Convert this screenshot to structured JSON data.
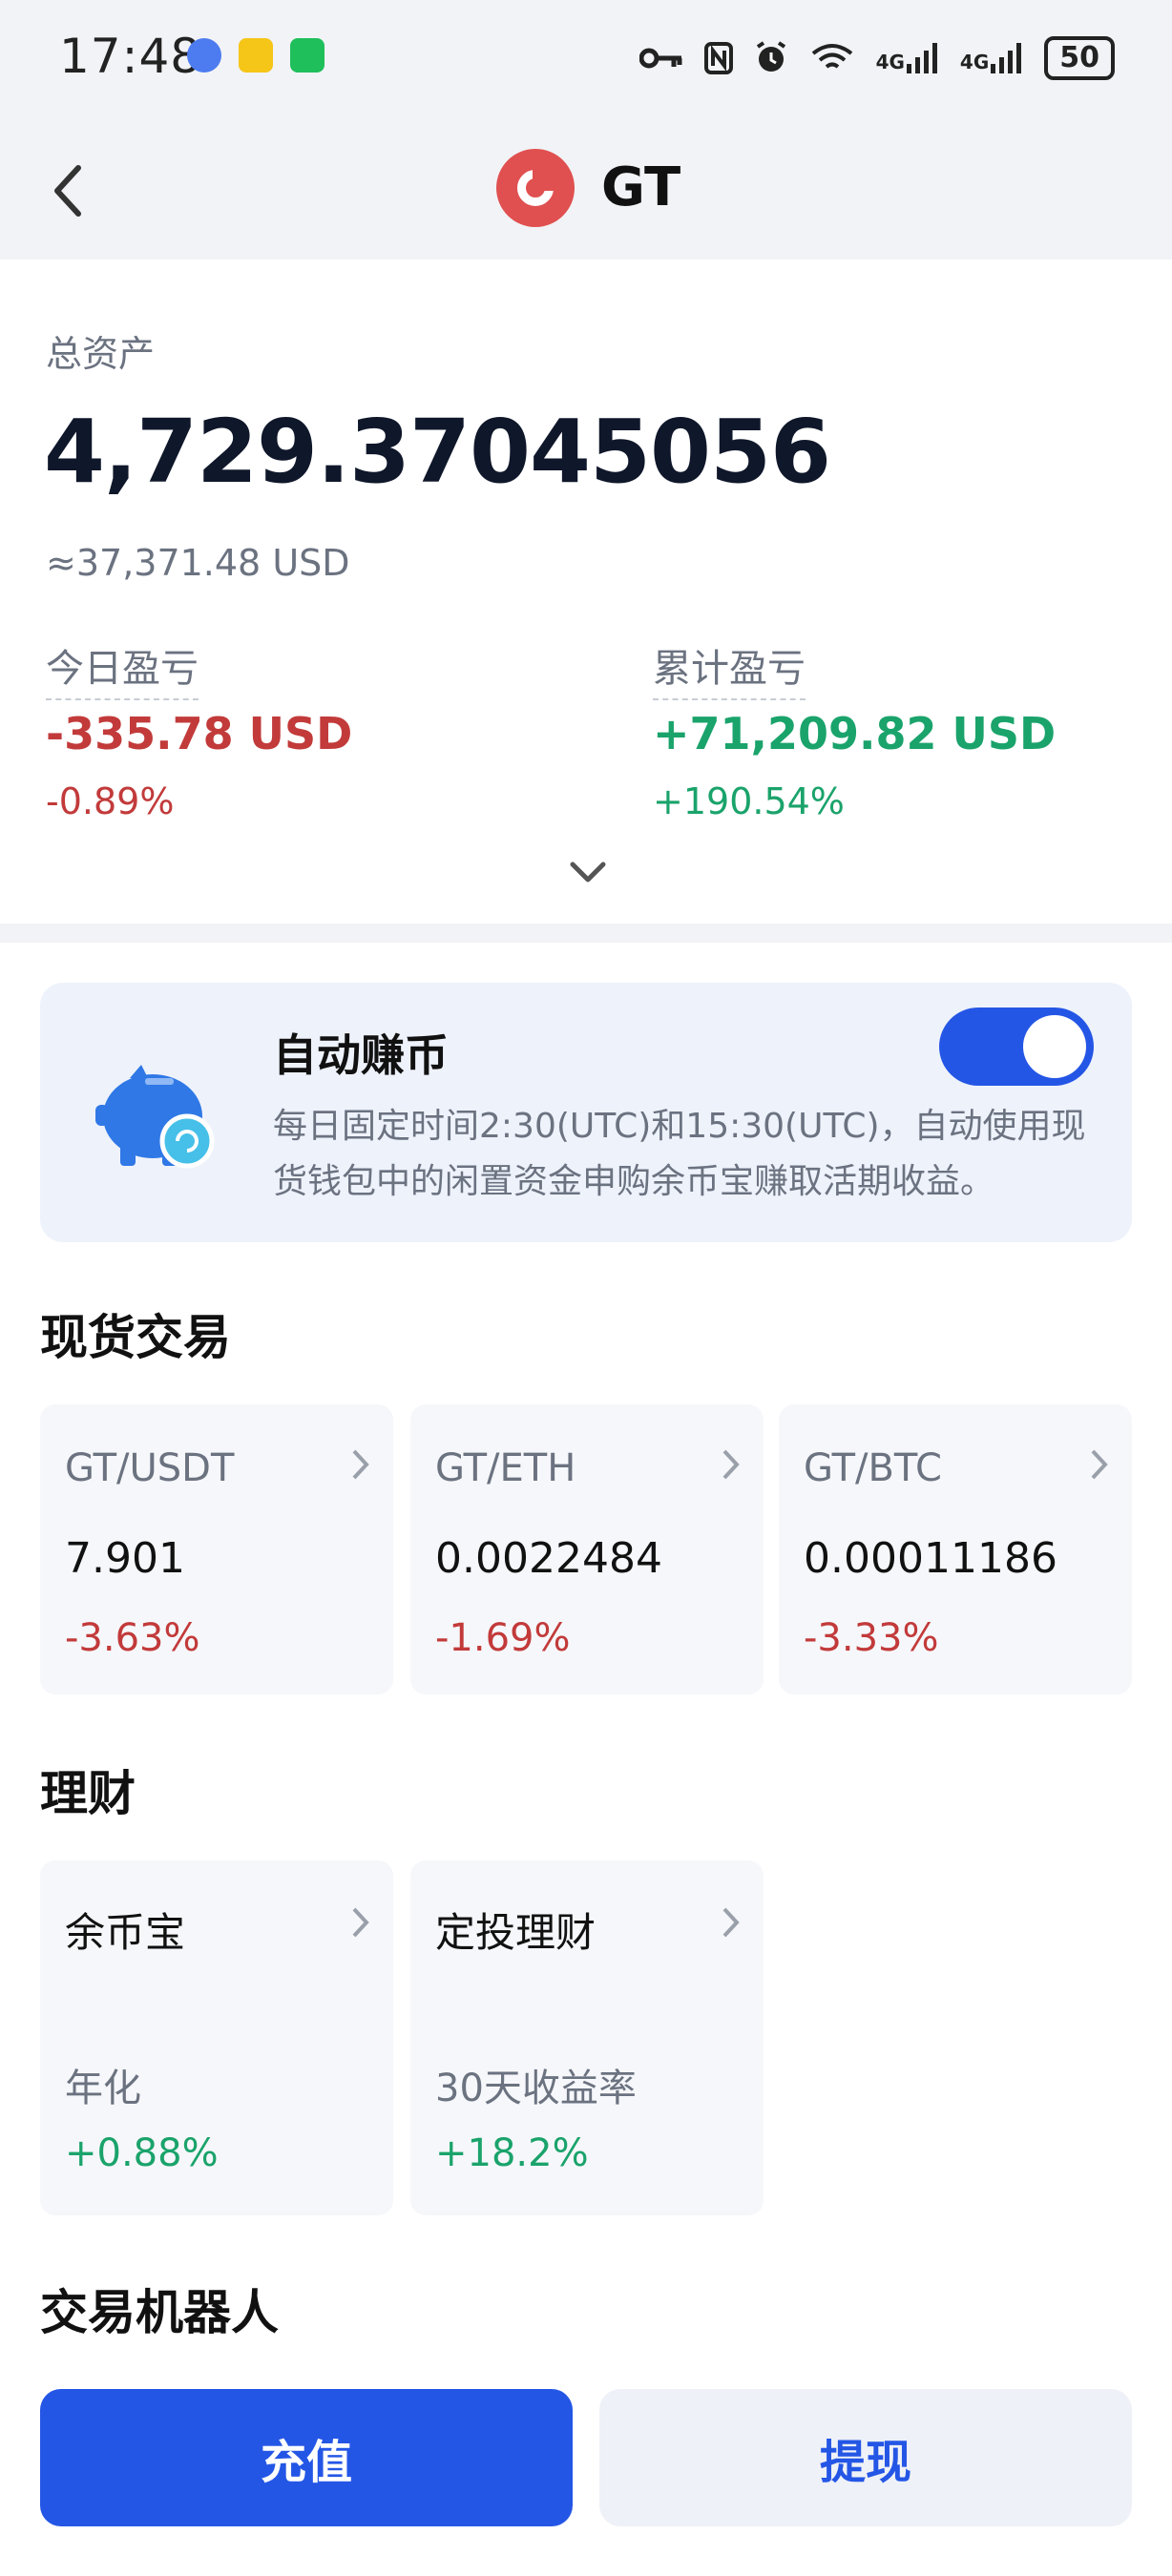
{
  "status_bar": {
    "time": "17:48",
    "network_1": "4G",
    "network_2": "4G",
    "battery": "50",
    "left_icons": [
      "app-icon-blue",
      "app-icon-yellow",
      "wechat-icon"
    ],
    "right_icons": [
      "key-icon",
      "nfc-icon",
      "alarm-icon",
      "wifi-icon",
      "signal-icon",
      "signal-icon",
      "battery-icon"
    ]
  },
  "header": {
    "title": "GT",
    "back_icon": "back-arrow-icon",
    "coin_icon": "gt-coin-icon"
  },
  "summary": {
    "total_label": "总资产",
    "total_value": "4,729.37045056",
    "approx_usd": "≈37,371.48 USD",
    "today": {
      "label": "今日盈亏",
      "value": "-335.78 USD",
      "pct": "-0.89%"
    },
    "cumulative": {
      "label": "累计盈亏",
      "value": "+71,209.82 USD",
      "pct": "+190.54%"
    }
  },
  "auto_earn": {
    "title": "自动赚币",
    "description": "每日固定时间2:30(UTC)和15:30(UTC)，自动使用现货钱包中的闲置资金申购余币宝赚取活期收益。",
    "toggle_on": true
  },
  "spot": {
    "title": "现货交易",
    "pairs": [
      {
        "pair": "GT/USDT",
        "price": "7.901",
        "change": "-3.63%"
      },
      {
        "pair": "GT/ETH",
        "price": "0.0022484",
        "change": "-1.69%"
      },
      {
        "pair": "GT/BTC",
        "price": "0.00011186",
        "change": "-3.33%"
      }
    ]
  },
  "finance": {
    "title": "理财",
    "items": [
      {
        "name": "余币宝",
        "metric_label": "年化",
        "metric_value": "+0.88%"
      },
      {
        "name": "定投理财",
        "metric_label": "30天收益率",
        "metric_value": "+18.2%"
      }
    ]
  },
  "bots": {
    "title": "交易机器人"
  },
  "actions": {
    "deposit": "充值",
    "withdraw": "提现"
  },
  "colors": {
    "accent": "#2456e6",
    "loss": "#c23a3a",
    "gain": "#1aa36b",
    "coin": "#e05050"
  }
}
